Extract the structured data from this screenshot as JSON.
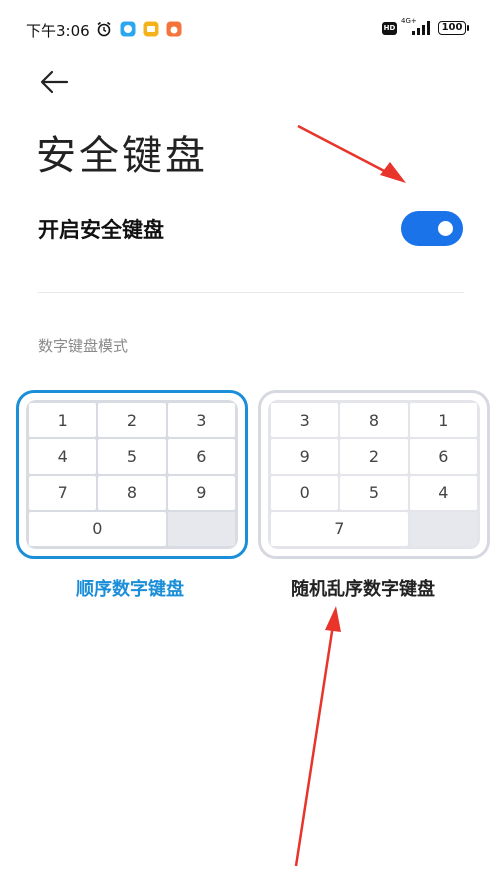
{
  "status_bar": {
    "time": "下午3:06",
    "network": "4G+",
    "battery": "100"
  },
  "header": {
    "title": "安全键盘"
  },
  "settings": {
    "secure_keyboard_label": "开启安全键盘",
    "secure_keyboard_enabled": true
  },
  "section": {
    "label": "数字键盘模式"
  },
  "keyboards": {
    "sequential": {
      "caption": "顺序数字键盘",
      "selected": true,
      "rows": [
        [
          "1",
          "2",
          "3"
        ],
        [
          "4",
          "5",
          "6"
        ],
        [
          "7",
          "8",
          "9"
        ],
        [
          "0"
        ]
      ]
    },
    "random": {
      "caption": "随机乱序数字键盘",
      "selected": false,
      "rows": [
        [
          "3",
          "8",
          "1"
        ],
        [
          "9",
          "2",
          "6"
        ],
        [
          "0",
          "5",
          "4"
        ],
        [
          "7"
        ]
      ]
    }
  },
  "colors": {
    "accent": "#1a73e8",
    "selected_border": "#1a8ed8",
    "annotation_arrow": "#e8342a"
  }
}
